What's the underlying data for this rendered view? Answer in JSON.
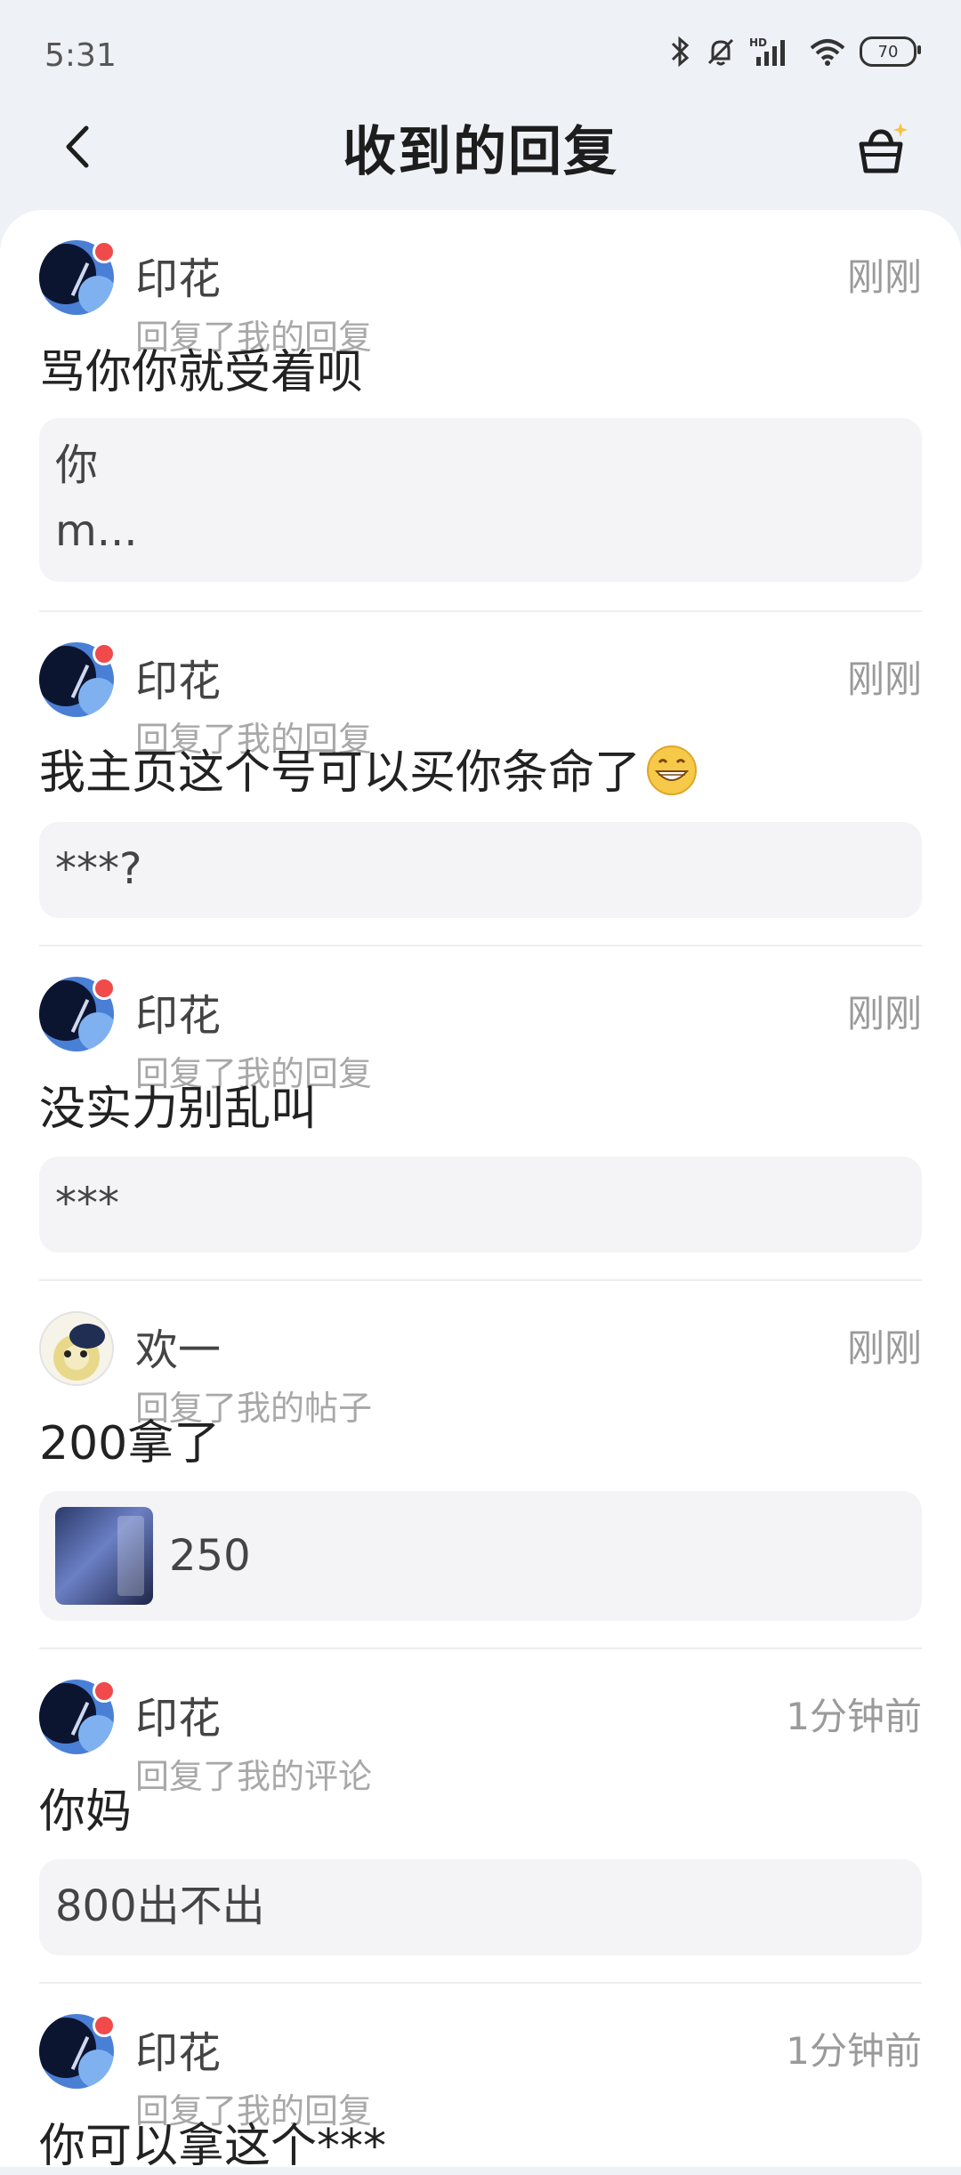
{
  "status": {
    "time": "5:31",
    "battery": "70",
    "signal_label": "HD"
  },
  "header": {
    "title": "收到的回复"
  },
  "items": [
    {
      "user": "印花",
      "time": "刚刚",
      "subtitle": "回复了我的回复",
      "content": "骂你你就受着呗",
      "quote": "你\nm..."
    },
    {
      "user": "印花",
      "time": "刚刚",
      "subtitle": "回复了我的回复",
      "content": "我主页这个号可以买你条命了",
      "quote": "***?"
    },
    {
      "user": "印花",
      "time": "刚刚",
      "subtitle": "回复了我的回复",
      "content": "没实力别乱叫",
      "quote": "***"
    },
    {
      "user": "欢一",
      "time": "刚刚",
      "subtitle": "回复了我的帖子",
      "content": "200拿了",
      "quote": "250"
    },
    {
      "user": "印花",
      "time": "1分钟前",
      "subtitle": "回复了我的评论",
      "content": "你妈",
      "quote": "800出不出"
    },
    {
      "user": "印花",
      "time": "1分钟前",
      "subtitle": "回复了我的回复",
      "content": "你可以拿这个***"
    }
  ],
  "colors": {
    "background": "#eef1f6",
    "card": "#ffffff",
    "quote_bg": "#f4f4f6",
    "unread_dot": "#f04a4a"
  }
}
